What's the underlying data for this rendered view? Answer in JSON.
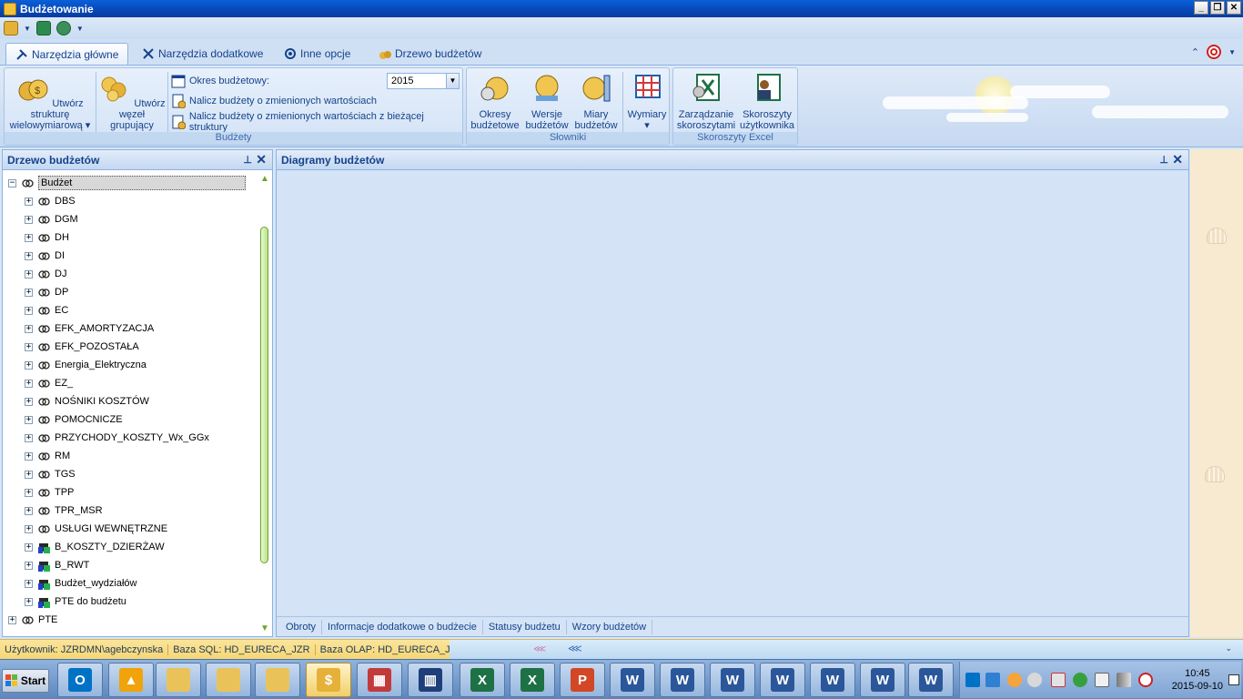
{
  "window": {
    "title": "Budżetowanie"
  },
  "tabs": [
    {
      "label": "Narzędzia główne",
      "icon": "tools-icon"
    },
    {
      "label": "Narzędzia dodatkowe",
      "icon": "wrench-icon"
    },
    {
      "label": "Inne opcje",
      "icon": "gear-icon"
    },
    {
      "label": "Drzewo budżetów",
      "icon": "money-bags-icon"
    }
  ],
  "ribbon": {
    "budzety": {
      "label": "Budżety",
      "create_multidim": "Utwórz strukturę wielowymiarową",
      "create_group": "Utwórz węzeł grupujący",
      "period_label": "Okres budżetowy:",
      "period_value": "2015",
      "recalc_changed": "Nalicz budżety o zmienionych wartościach",
      "recalc_current": "Nalicz budżety o zmienionych wartościach z bieżącej struktury"
    },
    "slowniki": {
      "label": "Słowniki",
      "periods": "Okresy budżetowe",
      "versions": "Wersje budżetów",
      "measures": "Miary budżetów",
      "dimensions": "Wymiary"
    },
    "excel": {
      "label": "Skoroszyty Excel",
      "manage": "Zarządzanie skoroszytami",
      "user": "Skoroszyty użytkownika"
    }
  },
  "tree_panel": {
    "title": "Drzewo budżetów",
    "root": "Budżet",
    "items": [
      "DBS",
      "DGM",
      "DH",
      "DI",
      "DJ",
      "DP",
      "EC",
      "EFK_AMORTYZACJA",
      "EFK_POZOSTAŁA",
      "Energia_Elektryczna",
      "EZ_",
      "NOŚNIKI KOSZTÓW",
      "POMOCNICZE",
      "PRZYCHODY_KOSZTY_Wx_GGx",
      "RM",
      "TGS",
      "TPP",
      "TPR_MSR",
      "USŁUGI WEWNĘTRZNE"
    ],
    "special_items": [
      "B_KOSZTY_DZIERŻAW",
      "B_RWT",
      "Budżet_wydziałów",
      "PTE do budżetu"
    ],
    "sibling": "PTE"
  },
  "diagram_panel": {
    "title": "Diagramy budżetów",
    "tabs": [
      "Obroty",
      "Informacje dodatkowe o budżecie",
      "Statusy budżetu",
      "Wzory budżetów"
    ]
  },
  "status": {
    "user": "Użytkownik: JZRDMN\\agebczynska",
    "sql": "Baza SQL: HD_EURECA_JZR",
    "olap": "Baza OLAP: HD_EURECA_JZR"
  },
  "taskbar": {
    "start": "Start",
    "clock_time": "10:45",
    "clock_date": "2015-09-10"
  },
  "colors": {
    "accent": "#15428b",
    "excel": "#1e7145",
    "word": "#2b579a",
    "powerpoint": "#d24726",
    "outlook": "#0072c6"
  }
}
